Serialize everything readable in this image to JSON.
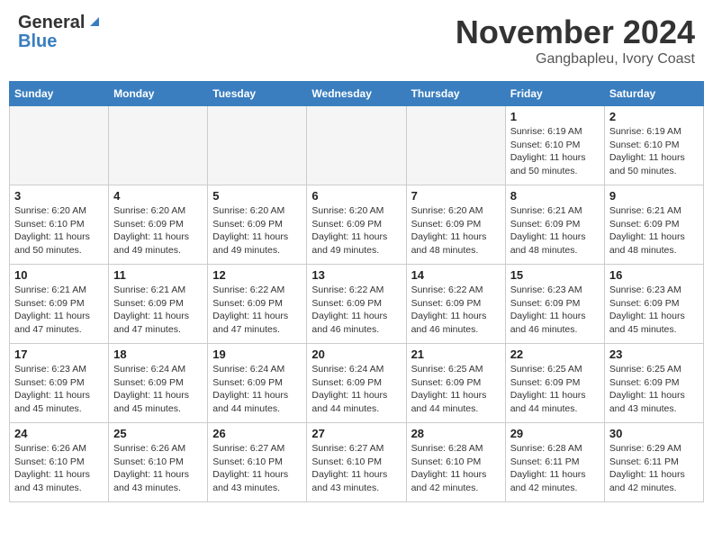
{
  "header": {
    "logo_line1": "General",
    "logo_line2": "Blue",
    "month_title": "November 2024",
    "location": "Gangbapleu, Ivory Coast"
  },
  "days_of_week": [
    "Sunday",
    "Monday",
    "Tuesday",
    "Wednesday",
    "Thursday",
    "Friday",
    "Saturday"
  ],
  "weeks": [
    [
      {
        "day": "",
        "empty": true
      },
      {
        "day": "",
        "empty": true
      },
      {
        "day": "",
        "empty": true
      },
      {
        "day": "",
        "empty": true
      },
      {
        "day": "",
        "empty": true
      },
      {
        "day": "1",
        "sunrise": "6:19 AM",
        "sunset": "6:10 PM",
        "daylight": "11 hours and 50 minutes."
      },
      {
        "day": "2",
        "sunrise": "6:19 AM",
        "sunset": "6:10 PM",
        "daylight": "11 hours and 50 minutes."
      }
    ],
    [
      {
        "day": "3",
        "sunrise": "6:20 AM",
        "sunset": "6:10 PM",
        "daylight": "11 hours and 50 minutes."
      },
      {
        "day": "4",
        "sunrise": "6:20 AM",
        "sunset": "6:09 PM",
        "daylight": "11 hours and 49 minutes."
      },
      {
        "day": "5",
        "sunrise": "6:20 AM",
        "sunset": "6:09 PM",
        "daylight": "11 hours and 49 minutes."
      },
      {
        "day": "6",
        "sunrise": "6:20 AM",
        "sunset": "6:09 PM",
        "daylight": "11 hours and 49 minutes."
      },
      {
        "day": "7",
        "sunrise": "6:20 AM",
        "sunset": "6:09 PM",
        "daylight": "11 hours and 48 minutes."
      },
      {
        "day": "8",
        "sunrise": "6:21 AM",
        "sunset": "6:09 PM",
        "daylight": "11 hours and 48 minutes."
      },
      {
        "day": "9",
        "sunrise": "6:21 AM",
        "sunset": "6:09 PM",
        "daylight": "11 hours and 48 minutes."
      }
    ],
    [
      {
        "day": "10",
        "sunrise": "6:21 AM",
        "sunset": "6:09 PM",
        "daylight": "11 hours and 47 minutes."
      },
      {
        "day": "11",
        "sunrise": "6:21 AM",
        "sunset": "6:09 PM",
        "daylight": "11 hours and 47 minutes."
      },
      {
        "day": "12",
        "sunrise": "6:22 AM",
        "sunset": "6:09 PM",
        "daylight": "11 hours and 47 minutes."
      },
      {
        "day": "13",
        "sunrise": "6:22 AM",
        "sunset": "6:09 PM",
        "daylight": "11 hours and 46 minutes."
      },
      {
        "day": "14",
        "sunrise": "6:22 AM",
        "sunset": "6:09 PM",
        "daylight": "11 hours and 46 minutes."
      },
      {
        "day": "15",
        "sunrise": "6:23 AM",
        "sunset": "6:09 PM",
        "daylight": "11 hours and 46 minutes."
      },
      {
        "day": "16",
        "sunrise": "6:23 AM",
        "sunset": "6:09 PM",
        "daylight": "11 hours and 45 minutes."
      }
    ],
    [
      {
        "day": "17",
        "sunrise": "6:23 AM",
        "sunset": "6:09 PM",
        "daylight": "11 hours and 45 minutes."
      },
      {
        "day": "18",
        "sunrise": "6:24 AM",
        "sunset": "6:09 PM",
        "daylight": "11 hours and 45 minutes."
      },
      {
        "day": "19",
        "sunrise": "6:24 AM",
        "sunset": "6:09 PM",
        "daylight": "11 hours and 44 minutes."
      },
      {
        "day": "20",
        "sunrise": "6:24 AM",
        "sunset": "6:09 PM",
        "daylight": "11 hours and 44 minutes."
      },
      {
        "day": "21",
        "sunrise": "6:25 AM",
        "sunset": "6:09 PM",
        "daylight": "11 hours and 44 minutes."
      },
      {
        "day": "22",
        "sunrise": "6:25 AM",
        "sunset": "6:09 PM",
        "daylight": "11 hours and 44 minutes."
      },
      {
        "day": "23",
        "sunrise": "6:25 AM",
        "sunset": "6:09 PM",
        "daylight": "11 hours and 43 minutes."
      }
    ],
    [
      {
        "day": "24",
        "sunrise": "6:26 AM",
        "sunset": "6:10 PM",
        "daylight": "11 hours and 43 minutes."
      },
      {
        "day": "25",
        "sunrise": "6:26 AM",
        "sunset": "6:10 PM",
        "daylight": "11 hours and 43 minutes."
      },
      {
        "day": "26",
        "sunrise": "6:27 AM",
        "sunset": "6:10 PM",
        "daylight": "11 hours and 43 minutes."
      },
      {
        "day": "27",
        "sunrise": "6:27 AM",
        "sunset": "6:10 PM",
        "daylight": "11 hours and 43 minutes."
      },
      {
        "day": "28",
        "sunrise": "6:28 AM",
        "sunset": "6:10 PM",
        "daylight": "11 hours and 42 minutes."
      },
      {
        "day": "29",
        "sunrise": "6:28 AM",
        "sunset": "6:11 PM",
        "daylight": "11 hours and 42 minutes."
      },
      {
        "day": "30",
        "sunrise": "6:29 AM",
        "sunset": "6:11 PM",
        "daylight": "11 hours and 42 minutes."
      }
    ]
  ]
}
